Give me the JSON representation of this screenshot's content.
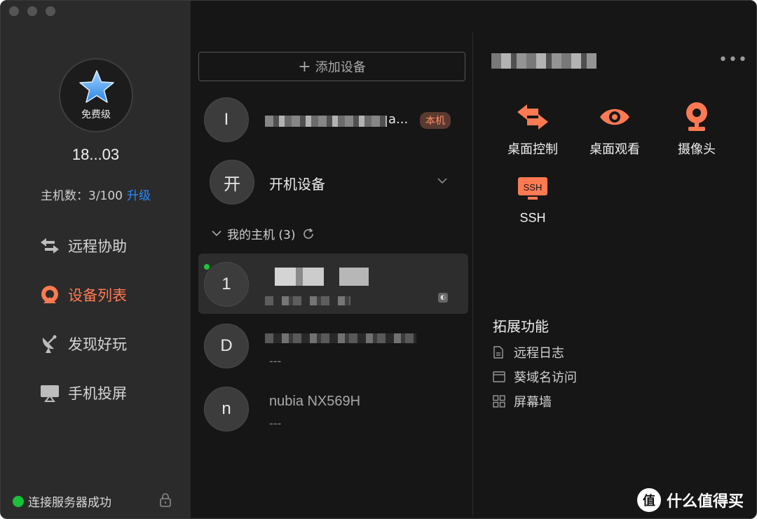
{
  "sidebar": {
    "tier": "免费级",
    "account": "18...03",
    "host_count_label": "主机数：3/100",
    "upgrade_label": "升级",
    "nav": [
      {
        "label": "远程协助",
        "icon": "remote-assist-icon"
      },
      {
        "label": "设备列表",
        "icon": "device-list-icon",
        "active": true
      },
      {
        "label": "发现好玩",
        "icon": "satellite-dish-icon"
      },
      {
        "label": "手机投屏",
        "icon": "screen-cast-icon"
      }
    ],
    "server_status": "连接服务器成功"
  },
  "device_list": {
    "add_device_label": "添加设备",
    "local_device": {
      "avatar": "I",
      "name_suffix": "a...",
      "tag": "本机"
    },
    "boot_device": {
      "avatar": "开",
      "label": "开机设备"
    },
    "group": {
      "label": "我的主机 (3)"
    },
    "hosts": [
      {
        "avatar": "1",
        "status": "",
        "online": true
      },
      {
        "avatar": "D",
        "status": "---"
      },
      {
        "avatar": "n",
        "name": "nubia NX569H",
        "status": "---"
      }
    ]
  },
  "detail": {
    "more_label": "•••",
    "actions": [
      {
        "label": "桌面控制",
        "icon": "desktop-control-icon"
      },
      {
        "label": "桌面观看",
        "icon": "eye-icon"
      },
      {
        "label": "摄像头",
        "icon": "camera-icon"
      },
      {
        "label": "SSH",
        "icon": "ssh-icon",
        "icon_text": "SSH"
      }
    ],
    "extensions_title": "拓展功能",
    "extensions": [
      {
        "label": "远程日志",
        "icon": "log-file-icon"
      },
      {
        "label": "葵域名访问",
        "icon": "browser-window-icon"
      },
      {
        "label": "屏幕墙",
        "icon": "grid-icon"
      }
    ]
  },
  "watermark": {
    "symbol": "值",
    "text": "什么值得买"
  },
  "colors": {
    "accent": "#ff7a52",
    "link": "#2a8cff",
    "online": "#19c23a"
  }
}
